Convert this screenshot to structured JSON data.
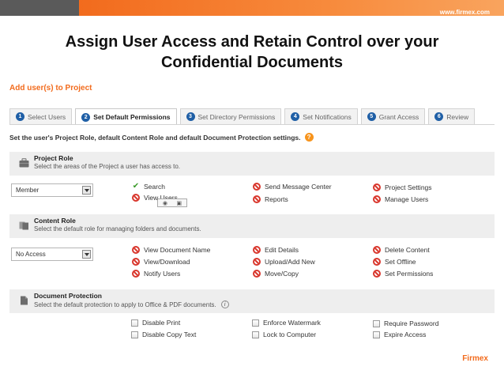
{
  "slide": {
    "url": "www.firmex.com",
    "title_line1": "Assign User Access and Retain Control over your",
    "title_line2": "Confidential Documents",
    "brand": "Firmex"
  },
  "page": {
    "heading": "Add user(s) to Project",
    "instruction": "Set the user's Project Role, default Content Role and default Document Protection settings."
  },
  "tabs": [
    {
      "num": "1",
      "label": "Select Users"
    },
    {
      "num": "2",
      "label": "Set Default Permissions"
    },
    {
      "num": "3",
      "label": "Set Directory Permissions"
    },
    {
      "num": "4",
      "label": "Set Notifications"
    },
    {
      "num": "5",
      "label": "Grant Access"
    },
    {
      "num": "6",
      "label": "Review"
    }
  ],
  "project_role": {
    "title": "Project Role",
    "description": "Select the areas of the Project a user has access to.",
    "selected": "Member",
    "permissions": {
      "search": "Search",
      "view_users": "View Users",
      "send_message_center": "Send Message Center",
      "reports": "Reports",
      "project_settings": "Project Settings",
      "manage_users": "Manage Users"
    },
    "tooltip_icons": [
      "eye-icon",
      "edit-icon"
    ]
  },
  "content_role": {
    "title": "Content Role",
    "description": "Select the default role for managing folders and documents.",
    "selected": "No Access",
    "permissions": {
      "view_document_name": "View Document Name",
      "view_download": "View/Download",
      "notify_users": "Notify Users",
      "edit_details": "Edit Details",
      "upload_add_new": "Upload/Add New",
      "move_copy": "Move/Copy",
      "delete_content": "Delete Content",
      "set_offline": "Set Offline",
      "set_permissions": "Set Permissions"
    }
  },
  "document_protection": {
    "title": "Document Protection",
    "description": "Select the default protection to apply to Office & PDF documents.",
    "info_label": "i",
    "options": {
      "disable_print": "Disable Print",
      "disable_copy_text": "Disable Copy Text",
      "enforce_watermark": "Enforce Watermark",
      "lock_to_computer": "Lock to Computer",
      "require_password": "Require Password",
      "expire_access": "Expire Access"
    }
  },
  "colors": {
    "accent": "#f26b1d",
    "tab_number": "#1f5fa6",
    "deny": "#d9382e",
    "allow": "#3a9a2a"
  }
}
